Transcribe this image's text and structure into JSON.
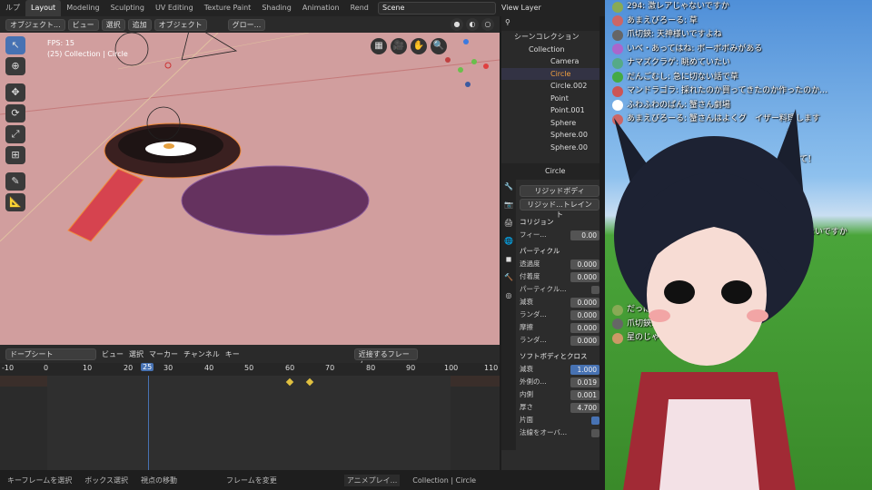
{
  "menubar": {
    "help_label": "ルプ"
  },
  "workspace_tabs": [
    "Layout",
    "Modeling",
    "Sculpting",
    "UV Editing",
    "Texture Paint",
    "Shading",
    "Animation",
    "Rend"
  ],
  "scene": {
    "name": "Scene"
  },
  "view_layer": {
    "label": "View Layer"
  },
  "viewport_header": {
    "mode": "オブジェクト...",
    "view": "ビュー",
    "select": "選択",
    "add": "追加",
    "object": "オブジェクト",
    "orientation": "グロー..."
  },
  "viewport": {
    "fps": "FPS: 15",
    "collection_info": "(25) Collection | Circle"
  },
  "outliner": {
    "header": "シーンコレクション",
    "items": [
      "Collection",
      "Camera",
      "Circle",
      "Circle.002",
      "Point",
      "Point.001",
      "Sphere",
      "Sphere.00",
      "Sphere.00",
      "Sphere.00"
    ]
  },
  "properties": {
    "object_name": "Circle",
    "buttons": [
      "リジッドボディ",
      "リジッド...トレイント"
    ],
    "sections": {
      "collision": "コリジョン",
      "particle": "パーティクル",
      "softbody": "ソフトボディとクロス"
    },
    "fields": [
      {
        "label": "フィー...",
        "value": "0.00"
      },
      {
        "label": "透過度",
        "value": "0.000"
      },
      {
        "label": "付着度",
        "value": "0.000"
      },
      {
        "label": "パーティクル...",
        "value": ""
      },
      {
        "label": "減衰",
        "value": "0.000"
      },
      {
        "label": "ランダ...",
        "value": "0.000"
      },
      {
        "label": "摩擦",
        "value": "0.000"
      },
      {
        "label": "ランダ...",
        "value": "0.000"
      }
    ],
    "soft_fields": [
      {
        "label": "減衰",
        "value": "1.000"
      },
      {
        "label": "外側の...",
        "value": "0.019"
      },
      {
        "label": "内側",
        "value": "0.001"
      },
      {
        "label": "厚さ",
        "value": "4.700"
      },
      {
        "label": "片面",
        "value": ""
      },
      {
        "label": "法線をオーバ...",
        "value": ""
      }
    ]
  },
  "timeline": {
    "editor": "ドープシート",
    "menus": [
      "ビュー",
      "選択",
      "マーカー",
      "チャンネル",
      "キー"
    ],
    "snap": "近接するフレーム",
    "current_frame": "25",
    "ruler": [
      "-10",
      "0",
      "10",
      "20",
      "25",
      "30",
      "40",
      "50",
      "60",
      "70",
      "80",
      "90",
      "100",
      "110"
    ]
  },
  "statusbar": {
    "items": [
      "キーフレームを選択",
      "ボックス選択",
      "視点の移動",
      "フレームを変更",
      "アニメプレイ...",
      "Collection | Circle"
    ]
  },
  "chat": {
    "lines": [
      {
        "text": "294: 激レアじゃないですか",
        "color": "#8a5"
      },
      {
        "text": "あまえびろーる: 草",
        "color": "#c66"
      },
      {
        "text": "爪切鋏: 天神様いですよね",
        "color": "#666"
      },
      {
        "text": "いべ・あってはね: ボーボボみがある",
        "color": "#a6c"
      },
      {
        "text": "ナマズクラゲ: 眺めていたい",
        "color": "#5a8"
      },
      {
        "text": "だんごむし: 急に切ない話で草",
        "color": "#4a4"
      },
      {
        "text": "マンドラゴラ: 採れたのか買ってきたのか作ったのか…",
        "color": "#c55"
      },
      {
        "text": "ふわふわのぱん: 蟹さん劇場",
        "color": "#fff"
      },
      {
        "text": "あまえびろーる: 蟹さんはよくグ　イザー料理します",
        "color": "#c66"
      },
      {
        "text": "ね",
        "color": ""
      },
      {
        "text": "て！",
        "color": ""
      },
      {
        "text": "ないですか",
        "color": ""
      },
      {
        "text": "だっぱ　　　まったか？？",
        "color": "#8a5"
      },
      {
        "text": "爪切鋏: キ　　　　　　！",
        "color": "#666"
      },
      {
        "text": "星のじゃ",
        "color": "#c96"
      }
    ]
  }
}
